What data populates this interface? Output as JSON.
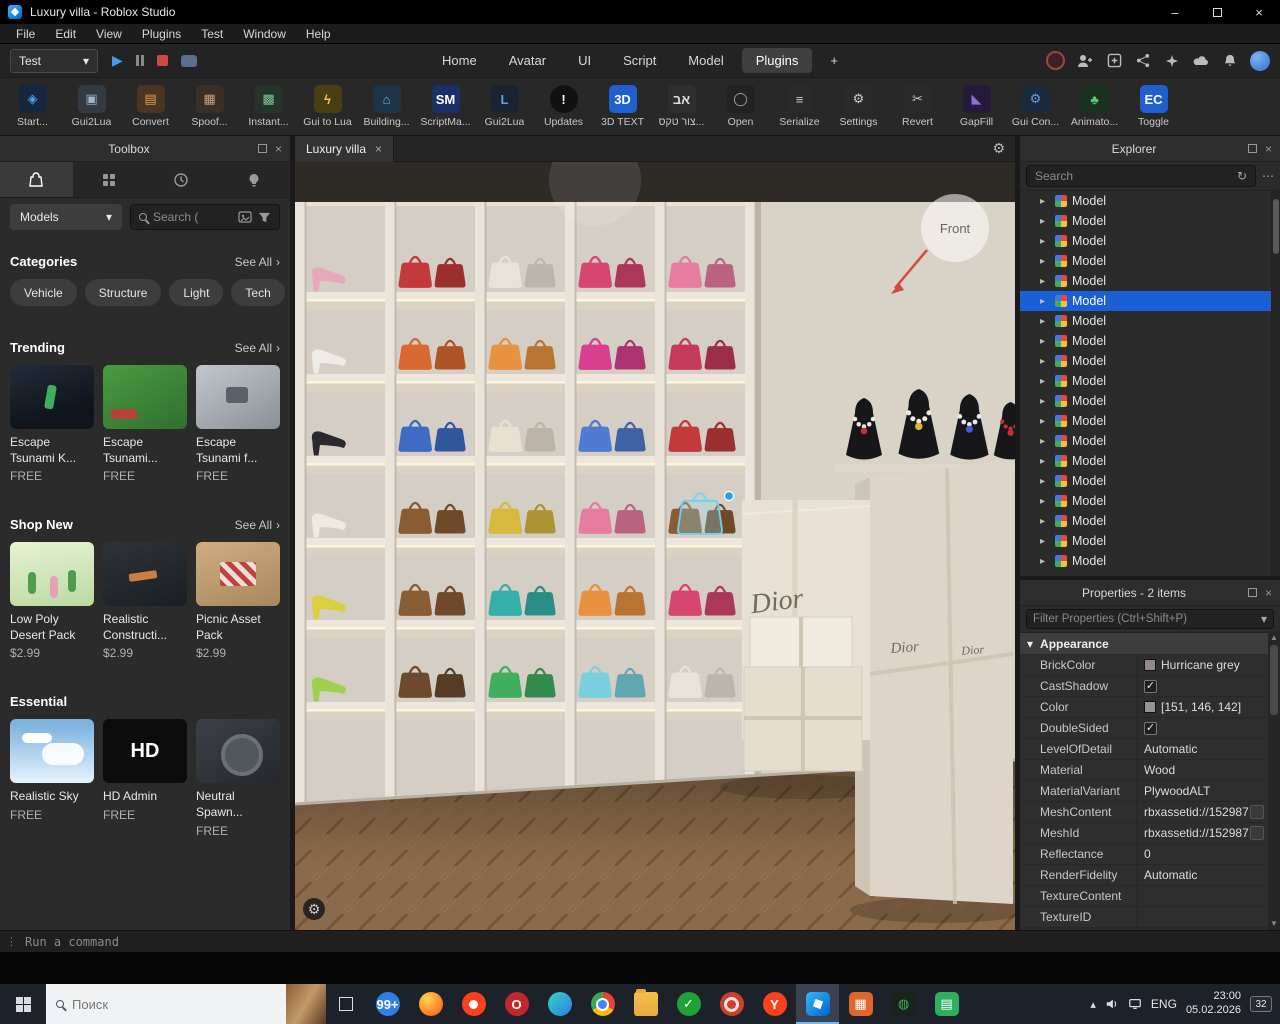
{
  "icons": {
    "dropdown": "▾",
    "expand": "▸",
    "close": "×",
    "minimize": "–",
    "more_h": "⋯",
    "grip": "⋮",
    "history": "↻",
    "gear": "⚙",
    "chevron_right": "›",
    "check": "✓",
    "scroll_up": "▲",
    "scroll_down": "▼",
    "tray_chevron": "▴",
    "play": "▶"
  },
  "window": {
    "title": "Luxury villa - Roblox Studio"
  },
  "menubar": {
    "items": [
      {
        "label": "File"
      },
      {
        "label": "Edit"
      },
      {
        "label": "View"
      },
      {
        "label": "Plugins"
      },
      {
        "label": "Test"
      },
      {
        "label": "Window"
      },
      {
        "label": "Help"
      }
    ]
  },
  "toolbar": {
    "playback_target": "Test",
    "tabs": [
      {
        "label": "Home"
      },
      {
        "label": "Avatar"
      },
      {
        "label": "UI"
      },
      {
        "label": "Script"
      },
      {
        "label": "Model"
      },
      {
        "label": "Plugins",
        "active": true
      },
      {
        "label": "+"
      }
    ]
  },
  "ribbon": {
    "items": [
      {
        "label": "Start...",
        "icon": "startup-plugin-icon",
        "glyph": "◈",
        "bg": "#16263f",
        "fg": "#4fa3e8"
      },
      {
        "label": "Gui2Lua",
        "icon": "gui2lua-plugin-icon",
        "glyph": "▣",
        "bg": "#333a44",
        "fg": "#9fb4c8"
      },
      {
        "label": "Convert",
        "icon": "convert-plugin-icon",
        "glyph": "▤",
        "bg": "#4a3522",
        "fg": "#e8a04f"
      },
      {
        "label": "Spoof...",
        "icon": "spoof-plugin-icon",
        "glyph": "▦",
        "bg": "#3a2e26",
        "fg": "#c89f7a"
      },
      {
        "label": "Instant...",
        "icon": "instant-plugin-icon",
        "glyph": "▩",
        "bg": "#26332a",
        "fg": "#7ac89a"
      },
      {
        "label": "Gui to Lua",
        "icon": "gui-to-lua-plugin-icon",
        "glyph": "ϟ",
        "bg": "#4a3d12",
        "fg": "#f0c93f"
      },
      {
        "label": "Building...",
        "icon": "building-tools-plugin-icon",
        "glyph": "⌂",
        "bg": "#1e3346",
        "fg": "#6fb3e8"
      },
      {
        "label": "ScriptMa...",
        "icon": "scriptmate-plugin-icon",
        "glyph": "SM",
        "bg": "#1a2f66",
        "fg": "#ffffff"
      },
      {
        "label": "Gui2Lua",
        "icon": "gui2lua-download-plugin-icon",
        "glyph": "L",
        "bg": "#1a2430",
        "fg": "#5f9fe8"
      },
      {
        "label": "Updates",
        "icon": "updates-plugin-icon",
        "glyph": "!",
        "bg": "#111111",
        "fg": "#ffffff",
        "round": true
      },
      {
        "label": "3D TEXT",
        "icon": "3d-text-plugin-icon",
        "glyph": "3D",
        "bg": "#1f5fd0",
        "fg": "#ffffff"
      },
      {
        "label": "צור טקס...",
        "icon": "hebrew-text-plugin-icon",
        "glyph": "אב",
        "bg": "#2e2e2e",
        "fg": "#dddddd"
      },
      {
        "label": "Open",
        "icon": "open-plugin-icon",
        "glyph": "◯",
        "bg": "#222222",
        "fg": "#aaaaaa"
      },
      {
        "label": "Serialize",
        "icon": "serialize-plugin-icon",
        "glyph": "≡",
        "bg": "#2a2a2a",
        "fg": "#cccccc"
      },
      {
        "label": "Settings",
        "icon": "settings-plugin-icon",
        "glyph": "⚙",
        "bg": "#2a2a2a",
        "fg": "#cccccc"
      },
      {
        "label": "Revert",
        "icon": "revert-plugin-icon",
        "glyph": "✂",
        "bg": "#2a2a2a",
        "fg": "#cccccc"
      },
      {
        "label": "GapFill",
        "icon": "gapfill-plugin-icon",
        "glyph": "◣",
        "bg": "#241a3a",
        "fg": "#8f6fe0"
      },
      {
        "label": "Gui Con...",
        "icon": "gui-converter-plugin-icon",
        "glyph": "⚙",
        "bg": "#1a2a3a",
        "fg": "#5f9fe8"
      },
      {
        "label": "Animato...",
        "icon": "animator-plugin-icon",
        "glyph": "♣",
        "bg": "#1a3320",
        "fg": "#5fc97a"
      },
      {
        "label": "Toggle",
        "icon": "event-code-toggle-plugin-icon",
        "glyph": "EC",
        "bg": "#1f5fd0",
        "fg": "#ffffff"
      }
    ]
  },
  "toolbox": {
    "title": "Toolbox",
    "marketplace_dropdown": "Models",
    "search_placeholder": "Search (",
    "categories": {
      "title": "Categories",
      "see_all": "See All",
      "pills": [
        {
          "label": "Vehicle"
        },
        {
          "label": "Structure"
        },
        {
          "label": "Light"
        },
        {
          "label": "Tech"
        }
      ]
    },
    "trending": {
      "title": "Trending",
      "see_all": "See All",
      "items": [
        {
          "name": "Escape Tsunami K...",
          "price": "FREE",
          "thumb": "thumb-escape1"
        },
        {
          "name": "Escape Tsunami...",
          "price": "FREE",
          "thumb": "thumb-escape2"
        },
        {
          "name": "Escape Tsunami f...",
          "price": "FREE",
          "thumb": "thumb-escape3"
        }
      ]
    },
    "shop_new": {
      "title": "Shop New",
      "see_all": "See All",
      "items": [
        {
          "name": "Low Poly Desert Pack",
          "price": "$2.99",
          "thumb": "thumb-desert"
        },
        {
          "name": "Realistic Constructi...",
          "price": "$2.99",
          "thumb": "thumb-construction"
        },
        {
          "name": "Picnic Asset Pack",
          "price": "$2.99",
          "thumb": "thumb-picnic"
        }
      ]
    },
    "essential": {
      "title": "Essential",
      "items": [
        {
          "name": "Realistic Sky",
          "price": "FREE",
          "thumb": "thumb-sky"
        },
        {
          "name": "HD Admin",
          "price": "FREE",
          "thumb": "thumb-hd",
          "thumb_text": "HD"
        },
        {
          "name": "Neutral Spawn...",
          "price": "FREE",
          "thumb": "thumb-spawn"
        }
      ]
    }
  },
  "viewport": {
    "tab": {
      "label": "Luxury villa"
    },
    "scene": {
      "front_label": "Front",
      "box_brand": "Dior",
      "shelf_rows": [
        {
          "shoe": "#e8a8bc",
          "bags": [
            "#c43a3a",
            "#e8e2d8",
            "#d8456e",
            "#e87ba0"
          ]
        },
        {
          "shoe": "#efece6",
          "bags": [
            "#d86a2f",
            "#e8913f",
            "#d83f8e",
            "#c43a5a"
          ]
        },
        {
          "shoe": "#2a2a2e",
          "bags": [
            "#3f6bc4",
            "#e8e0d0",
            "#4f7bd0",
            "#c43a3a"
          ]
        },
        {
          "shoe": "#efe9df",
          "bags": [
            "#8a5c34",
            "#d8b93f",
            "#e87ba0",
            "#8a5c34"
          ]
        },
        {
          "shoe": "#d8d03f",
          "bags": [
            "#8a5c34",
            "#35b0a8",
            "#e8913f",
            "#d8456e"
          ]
        },
        {
          "shoe": "#9fd04f",
          "bags": [
            "#6b4a2e",
            "#3fae5f",
            "#7bd0e0",
            "#e8e2d8"
          ]
        }
      ]
    }
  },
  "explorer": {
    "title": "Explorer",
    "search_placeholder": "Search",
    "items": [
      {
        "label": "Model"
      },
      {
        "label": "Model"
      },
      {
        "label": "Model"
      },
      {
        "label": "Model"
      },
      {
        "label": "Model"
      },
      {
        "label": "Model",
        "selected": true
      },
      {
        "label": "Model"
      },
      {
        "label": "Model"
      },
      {
        "label": "Model"
      },
      {
        "label": "Model"
      },
      {
        "label": "Model"
      },
      {
        "label": "Model"
      },
      {
        "label": "Model"
      },
      {
        "label": "Model"
      },
      {
        "label": "Model"
      },
      {
        "label": "Model"
      },
      {
        "label": "Model"
      },
      {
        "label": "Model"
      },
      {
        "label": "Model"
      }
    ]
  },
  "properties": {
    "title": "Properties - 2 items",
    "filter_placeholder": "Filter Properties (Ctrl+Shift+P)",
    "section": "Appearance",
    "rows": [
      {
        "name": "BrickColor",
        "value": "Hurricane grey",
        "type": "swatch",
        "swatch": "#958988"
      },
      {
        "name": "CastShadow",
        "value": "",
        "type": "check",
        "checked": true
      },
      {
        "name": "Color",
        "value": "[151, 146, 142]",
        "type": "swatch",
        "swatch": "#97928e"
      },
      {
        "name": "DoubleSided",
        "value": "",
        "type": "check",
        "checked": true
      },
      {
        "name": "LevelOfDetail",
        "value": "Automatic",
        "type": "text"
      },
      {
        "name": "Material",
        "value": "Wood",
        "type": "text"
      },
      {
        "name": "MaterialVariant",
        "value": "PlywoodALT",
        "type": "text"
      },
      {
        "name": "MeshContent",
        "value": "rbxassetid://152987",
        "type": "asset"
      },
      {
        "name": "MeshId",
        "value": "rbxassetid://152987",
        "type": "asset"
      },
      {
        "name": "Reflectance",
        "value": "0",
        "type": "text"
      },
      {
        "name": "RenderFidelity",
        "value": "Automatic",
        "type": "text"
      },
      {
        "name": "TextureContent",
        "value": "",
        "type": "text"
      },
      {
        "name": "TextureID",
        "value": "",
        "type": "text"
      }
    ]
  },
  "command_bar": {
    "placeholder": "Run a command"
  },
  "taskbar": {
    "search_placeholder": "Поиск",
    "apps": [
      {
        "name": "taskbar-widgets-badge",
        "cls": "circle",
        "bg": "#2f7fe8",
        "fg": "#ffffff",
        "glyph": "99+",
        "small": true
      },
      {
        "name": "taskbar-firefox-icon",
        "cls": "circle",
        "bg": "radial-gradient(circle at 35% 30%, #ffd54f, #ff8c2e 55%, #e0561e)"
      },
      {
        "name": "taskbar-yandex-browser-icon",
        "cls": "circle dot",
        "bg": "#fc3f1d"
      },
      {
        "name": "taskbar-opera-icon",
        "cls": "circle",
        "bg": "#c1272d",
        "fg": "#ffffff",
        "glyph": "O"
      },
      {
        "name": "taskbar-edge-icon",
        "cls": "circle",
        "bg": "linear-gradient(135deg,#35d2c0,#2f7fe8)"
      },
      {
        "name": "taskbar-chrome-icon",
        "cls": "circle chrome"
      },
      {
        "name": "taskbar-folder-icon",
        "cls": "folder"
      },
      {
        "name": "taskbar-sber-icon",
        "cls": "circle",
        "bg": "#21a038",
        "fg": "#ffffff",
        "glyph": "✓"
      },
      {
        "name": "taskbar-rust-icon",
        "cls": "circle ring",
        "bg": "#cd412b"
      },
      {
        "name": "taskbar-yandex-icon",
        "cls": "circle",
        "bg": "#fc3f1d",
        "fg": "#ffffff",
        "glyph": "Y"
      },
      {
        "name": "taskbar-roblox-studio-icon",
        "cls": "square roblox",
        "active": true
      },
      {
        "name": "taskbar-bricks-icon",
        "cls": "square",
        "bg": "#e0662e",
        "fg": "#ffffff",
        "glyph": "▦"
      },
      {
        "name": "taskbar-earth-icon",
        "cls": "square",
        "bg": "#18231b",
        "fg": "#3fae5f",
        "glyph": "◍"
      },
      {
        "name": "taskbar-calendar-icon",
        "cls": "square",
        "bg": "#2fae5f",
        "fg": "#ffffff",
        "glyph": "▤"
      }
    ],
    "tray": {
      "language": "ENG",
      "time": "23:00",
      "date": "05.02.2026",
      "badge": "32"
    }
  }
}
